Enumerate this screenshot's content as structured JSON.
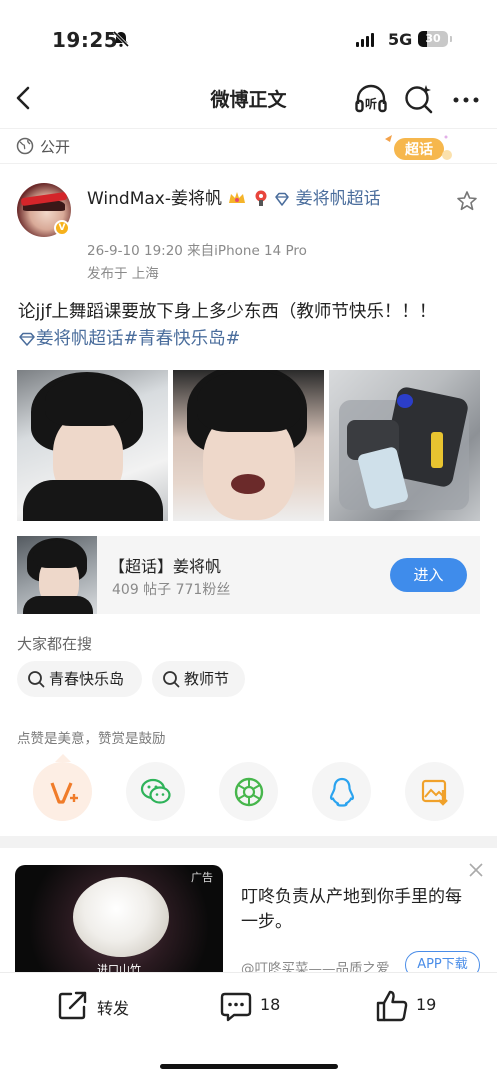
{
  "status_bar": {
    "time": "19:25",
    "network": "5G",
    "battery": "30",
    "battery_fraction": 0.3
  },
  "nav": {
    "title": "微博正文",
    "listen_label": "听"
  },
  "visibility": {
    "label": "公开",
    "badge": "超话"
  },
  "post": {
    "author": "WindMax-姜将帆",
    "topic_badge": "姜将帆超话",
    "datetime_source": "26-9-10 19:20  来自iPhone 14 Pro",
    "location": "发布于 上海",
    "text": "论jjf上舞蹈课要放下身上多少东西（教师节快乐！！！",
    "tags": [
      "姜将帆超话",
      "#青春快乐岛#"
    ]
  },
  "topic_card": {
    "title": "【超话】姜将帆",
    "stats": "409 帖子  771粉丝",
    "button": "进入"
  },
  "trending": {
    "label": "大家都在搜",
    "chips": [
      "青春快乐岛",
      "教师节"
    ]
  },
  "share": {
    "tip": "点赞是美意，赞赏是鼓励",
    "icons": [
      "tip-icon",
      "wechat-icon",
      "moments-icon",
      "qq-icon",
      "save-image-icon"
    ]
  },
  "ad": {
    "tag": "广告",
    "image_text": "进口山竹",
    "title": "叮咚负责从产地到你手里的每一步。",
    "source": "@叮咚买菜——品质之爱",
    "button": "APP下载"
  },
  "actions": {
    "repost_label": "转发",
    "comments_count": "18",
    "likes_count": "19"
  }
}
